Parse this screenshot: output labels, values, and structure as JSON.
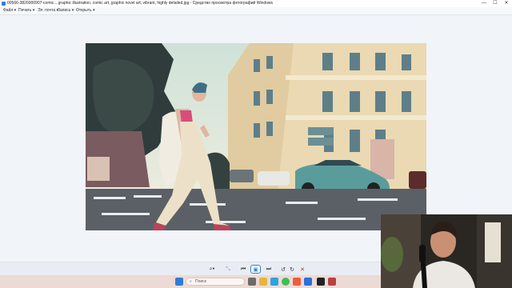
{
  "window": {
    "title": "00566-3820000907-comic... graphic illustration, comic art, graphic novel art, vibrant, highly detailed.jpg - Средство просмотра фотографий Windows",
    "controls": {
      "minimize": "—",
      "maximize": "☐",
      "close": "✕"
    }
  },
  "menu": {
    "file": "Файл ▾",
    "print": "Печать ▾",
    "email": "Эл. почта ▾",
    "burn": "Запись ▾",
    "open": "Открыть ▾"
  },
  "toolbar": {
    "zoom": "⌕▾",
    "fit": "⤡",
    "prev": "⏮",
    "play": "▣",
    "next": "⏭",
    "rotate_left": "↺",
    "rotate_right": "↻",
    "delete": "✕"
  },
  "taskbar": {
    "search_placeholder": "Поиск"
  },
  "colors": {
    "accent": "#2d7fd3",
    "delete": "#c8312a"
  },
  "icons": {
    "start": "windows-icon",
    "search": "search-icon"
  }
}
